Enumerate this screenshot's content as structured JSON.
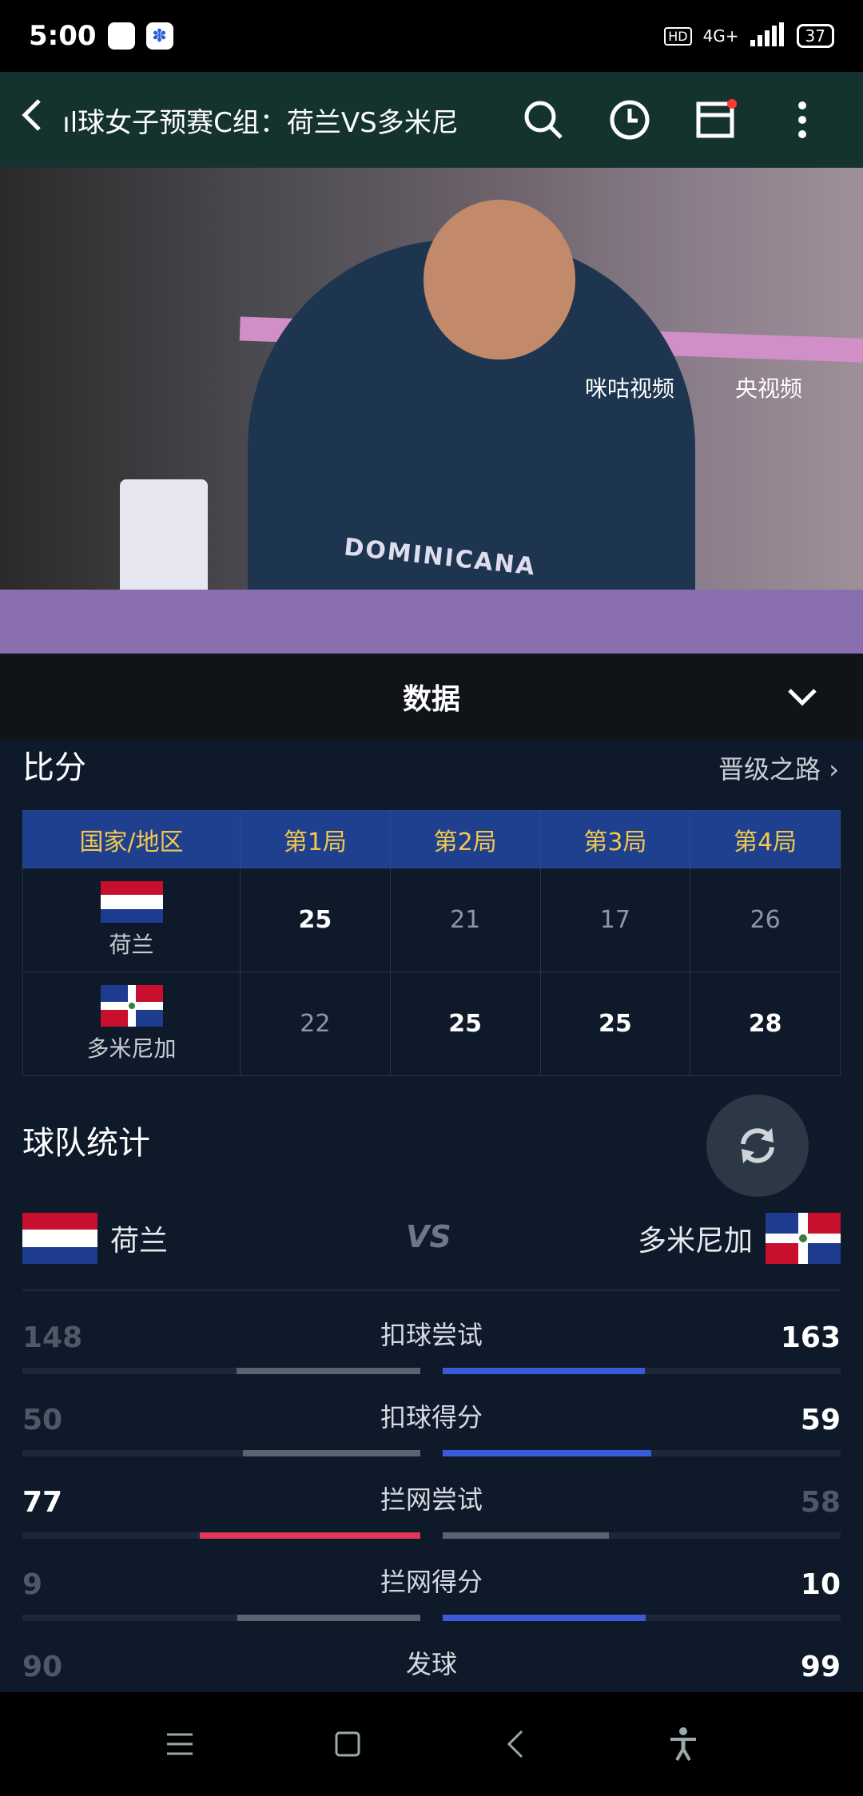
{
  "status_bar": {
    "time": "5:00",
    "network": "4G+",
    "hd": "HD",
    "battery": "37"
  },
  "header": {
    "title": "ıl球女子预赛C组：荷兰VS多米尼"
  },
  "video": {
    "shirt_text": "DOMINICANA",
    "watermark_migu": "咪咕视频",
    "watermark_cctv": "央视频"
  },
  "sheet": {
    "title": "数据"
  },
  "score": {
    "section_title": "比分",
    "link_label": "晋级之路",
    "columns": [
      "国家/地区",
      "第1局",
      "第2局",
      "第3局",
      "第4局"
    ],
    "rows": [
      {
        "team": "荷兰",
        "sets": [
          "25",
          "21",
          "17",
          "26"
        ]
      },
      {
        "team": "多米尼加",
        "sets": [
          "22",
          "25",
          "25",
          "28"
        ]
      }
    ]
  },
  "team_stats": {
    "section_title": "球队统计",
    "left_team": "荷兰",
    "right_team": "多米尼加",
    "vs_label": "VS",
    "rows": [
      {
        "label": "扣球尝试",
        "left": "148",
        "right": "163"
      },
      {
        "label": "扣球得分",
        "left": "50",
        "right": "59"
      },
      {
        "label": "拦网尝试",
        "left": "77",
        "right": "58"
      },
      {
        "label": "拦网得分",
        "left": "9",
        "right": "10"
      },
      {
        "label": "发球",
        "left": "90",
        "right": "99"
      }
    ]
  },
  "colors": {
    "accent_blue": "#3a5bd9",
    "accent_red": "#e0365a",
    "loser_bar": "#5a6470",
    "header_bg": "#1f3f8f"
  }
}
